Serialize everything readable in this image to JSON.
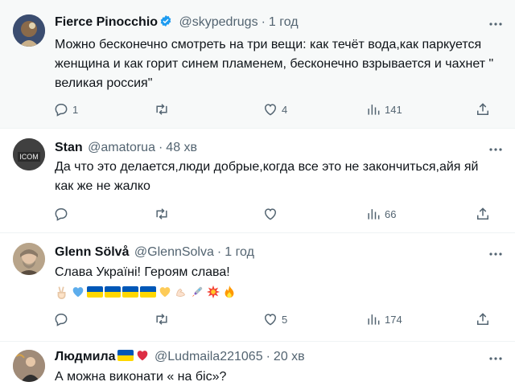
{
  "tweets": [
    {
      "name": "Fierce Pinocchio",
      "handle": "@skypedrugs",
      "time": "1 год",
      "text": "Можно бесконечно смотреть на три вещи: как течёт вода,как паркуется женщина и как горит синем пламенем, бесконечно взрывается и чахнет \" великая россия\"",
      "replies": "1",
      "retweets": "",
      "likes": "4",
      "views": "141"
    },
    {
      "name": "Stan",
      "handle": "@amatorua",
      "time": "48 хв",
      "text": "Да что это делается,люди добрые,когда все это не закончиться,айя яй как же не жалко",
      "replies": "",
      "retweets": "",
      "likes": "",
      "views": "66",
      "avatar_text": "ICOM"
    },
    {
      "name": "Glenn Sölvå",
      "handle": "@GlennSolva",
      "time": "1 год",
      "text": "Слава Україні! Героям слава!",
      "replies": "",
      "retweets": "",
      "likes": "5",
      "views": "174"
    },
    {
      "name": "Людмила",
      "handle": "@Ludmaila221065",
      "time": "20 хв",
      "text": "А можна виконати « на біс»?"
    }
  ],
  "separator": "·",
  "more_icon": "more-horizontal-icon",
  "colors": {
    "verified": "#1d9bf0",
    "muted": "#536471",
    "highlight_bg": "#f7f9f9",
    "flag_blue": "#0057b7",
    "flag_yellow": "#ffd700"
  }
}
